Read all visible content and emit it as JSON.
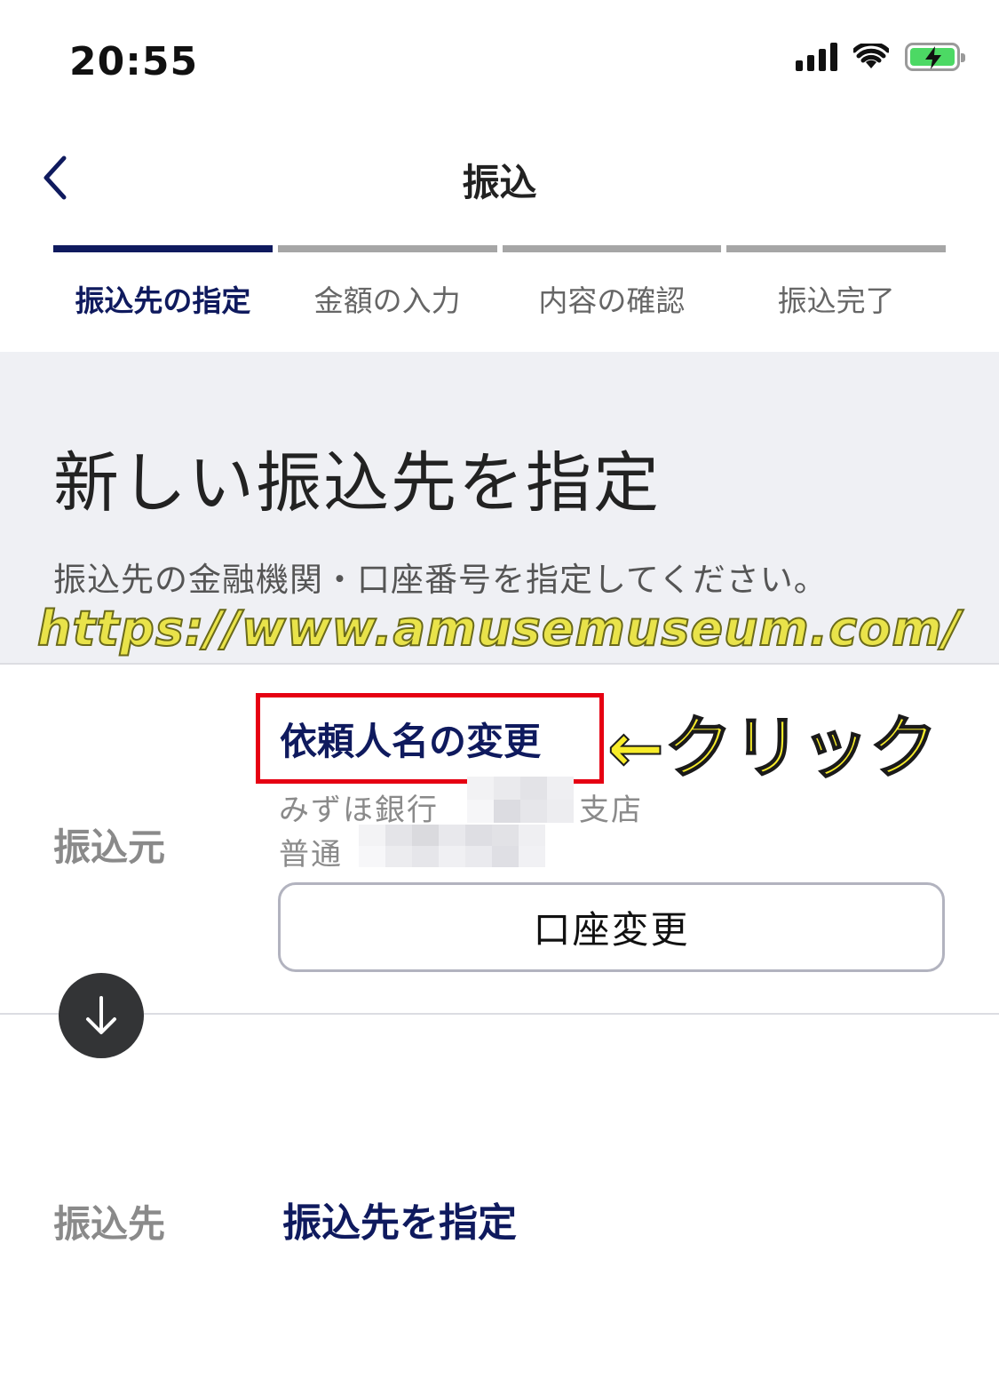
{
  "status_bar": {
    "time": "20:55"
  },
  "nav": {
    "title": "振込"
  },
  "steps": [
    {
      "label": "振込先の指定",
      "active": true
    },
    {
      "label": "金額の入力",
      "active": false
    },
    {
      "label": "内容の確認",
      "active": false
    },
    {
      "label": "振込完了",
      "active": false
    }
  ],
  "intro": {
    "title": "新しい振込先を指定",
    "description": "振込先の金融機関・口座番号を指定してください。",
    "watermark": "https://www.amusemuseum.com/"
  },
  "from": {
    "label": "振込元",
    "requester_link": "依頼人名の変更",
    "annotation": "←クリック",
    "bank": "みずほ銀行",
    "branch_suffix": "支店",
    "account_type": "普通",
    "change_button": "口座変更"
  },
  "to": {
    "label": "振込先",
    "select_link": "振込先を指定"
  },
  "colors": {
    "accent": "#0f1a5e",
    "highlight_box": "#e60012",
    "annotation": "#f7ec2a"
  }
}
